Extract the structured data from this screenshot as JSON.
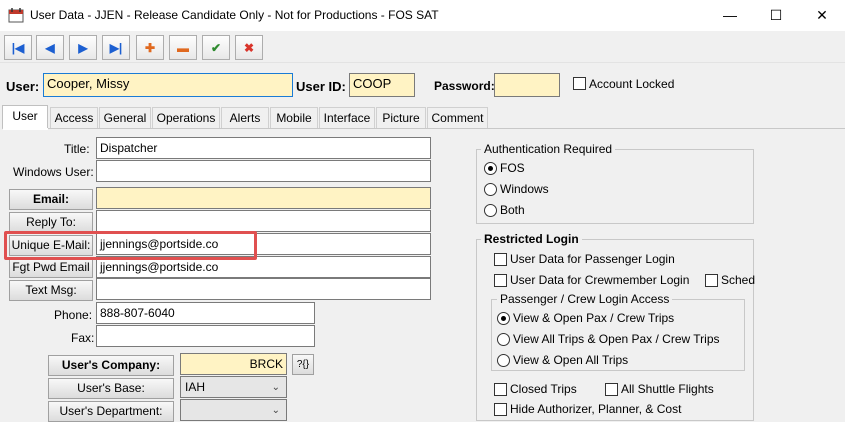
{
  "window": {
    "title": "User Data - JJEN - Release Candidate Only - Not for Productions - FOS SAT",
    "minimize": "—",
    "maximize": "☐",
    "close": "✕"
  },
  "toolbar": {
    "first": "|◀",
    "prev": "◀",
    "next": "▶",
    "last": "▶|",
    "add": "✚",
    "remove": "▬",
    "accept": "✔",
    "cancel": "✖"
  },
  "header": {
    "user_label": "User:",
    "user_value": "Cooper, Missy",
    "user_id_label": "User ID:",
    "user_id_value": "COOP",
    "password_label": "Password:",
    "password_value": "",
    "account_locked_label": "Account Locked"
  },
  "tabs": [
    "User",
    "Access",
    "General",
    "Operations",
    "Alerts",
    "Mobile",
    "Interface",
    "Picture",
    "Comment"
  ],
  "form": {
    "title_label": "Title:",
    "title_value": "Dispatcher",
    "windows_user_label": "Windows User:",
    "windows_user_value": "",
    "email_label": "Email:",
    "email_value": "",
    "reply_to_label": "Reply To:",
    "reply_to_value": "",
    "unique_email_label": "Unique E-Mail:",
    "unique_email_value": "jjennings@portside.co",
    "fgt_pwd_label": "Fgt Pwd Email",
    "fgt_pwd_value": "jjennings@portside.co",
    "text_msg_label": "Text Msg:",
    "text_msg_value": "",
    "phone_label": "Phone:",
    "phone_value": "888-807-6040",
    "fax_label": "Fax:",
    "fax_value": "",
    "company_label": "User's Company:",
    "company_value": "BRCK",
    "company_lookup": "?{}",
    "base_label": "User's Base:",
    "base_value": "IAH",
    "department_label": "User's Department:",
    "department_value": ""
  },
  "auth": {
    "title": "Authentication Required",
    "options": [
      "FOS",
      "Windows",
      "Both"
    ],
    "selected": "FOS"
  },
  "restricted": {
    "title": "Restricted Login",
    "passenger_label": "User Data for Passenger Login",
    "crew_label": "User Data for Crewmember Login",
    "sched_label": "Sched",
    "access_title": "Passenger / Crew Login Access",
    "access_options": [
      "View & Open Pax / Crew Trips",
      "View All Trips & Open Pax / Crew Trips",
      "View & Open All Trips"
    ],
    "access_selected": "View & Open Pax / Crew Trips",
    "closed_trips_label": "Closed Trips",
    "all_shuttle_label": "All Shuttle Flights",
    "hide_authorizer_label": "Hide Authorizer, Planner, & Cost"
  },
  "colors": {
    "highlight_box": "#e05050",
    "yellow_field": "#fff3c4",
    "toolbar_blue": "#1c5fd1",
    "toolbar_red": "#d9352b",
    "toolbar_green": "#2e8b2e",
    "toolbar_orange": "#e0691f"
  }
}
